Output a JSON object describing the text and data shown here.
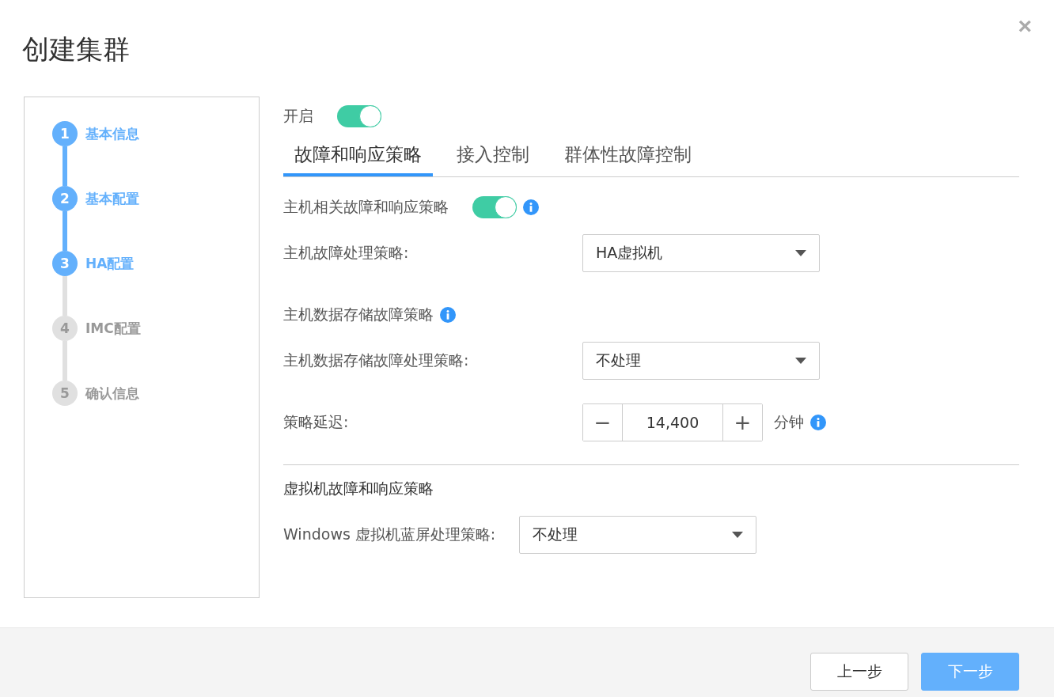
{
  "dialog": {
    "title": "创建集群",
    "close": "×"
  },
  "steps": [
    {
      "number": "1",
      "label": "基本信息",
      "active": true
    },
    {
      "number": "2",
      "label": "基本配置",
      "active": true
    },
    {
      "number": "3",
      "label": "HA配置",
      "active": true
    },
    {
      "number": "4",
      "label": "IMC配置",
      "active": false
    },
    {
      "number": "5",
      "label": "确认信息",
      "active": false
    }
  ],
  "enable": {
    "label": "开启",
    "on": true
  },
  "tabs": [
    {
      "label": "故障和响应策略",
      "selected": true
    },
    {
      "label": "接入控制",
      "selected": false
    },
    {
      "label": "群体性故障控制",
      "selected": false
    }
  ],
  "host_policy": {
    "label": "主机相关故障和响应策略",
    "on": true,
    "info": true,
    "fields": [
      {
        "kind": "select",
        "label": "主机故障处理策略:",
        "value": "HA虚拟机"
      }
    ]
  },
  "datastore_policy": {
    "label": "主机数据存储故障策略",
    "info": true,
    "fields": [
      {
        "kind": "select",
        "label": "主机数据存储故障处理策略:",
        "value": "不处理"
      },
      {
        "kind": "stepper",
        "label": "策略延迟:",
        "minus": "−",
        "value": "14,400",
        "plus": "+",
        "unit": "分钟",
        "info": true
      }
    ]
  },
  "vm_policy": {
    "label": "虚拟机故障和响应策略",
    "fields": [
      {
        "kind": "select",
        "label": "Windows 虚拟机蓝屏处理策略:",
        "value": "不处理"
      }
    ]
  },
  "footer": {
    "buttons": [
      {
        "label": "上一步",
        "kind": "secondary"
      },
      {
        "label": "下一步",
        "kind": "primary"
      }
    ]
  }
}
